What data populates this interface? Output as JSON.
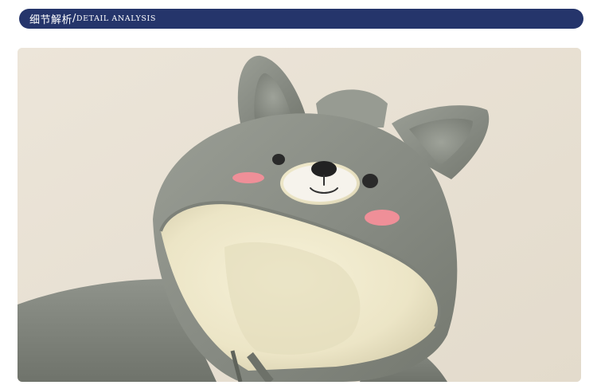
{
  "banner": {
    "title_zh": "细节解析",
    "separator": "/",
    "title_en": "DETAIL ANALYSIS",
    "color": "#25356b"
  },
  "photo": {
    "subject": "hood-with-ears",
    "colors": {
      "background": "#e9e1d4",
      "fabric": "#8c9088",
      "lining": "#efe9cf",
      "blush": "#ef8f98",
      "muzzle": "#f6f3ec"
    }
  }
}
